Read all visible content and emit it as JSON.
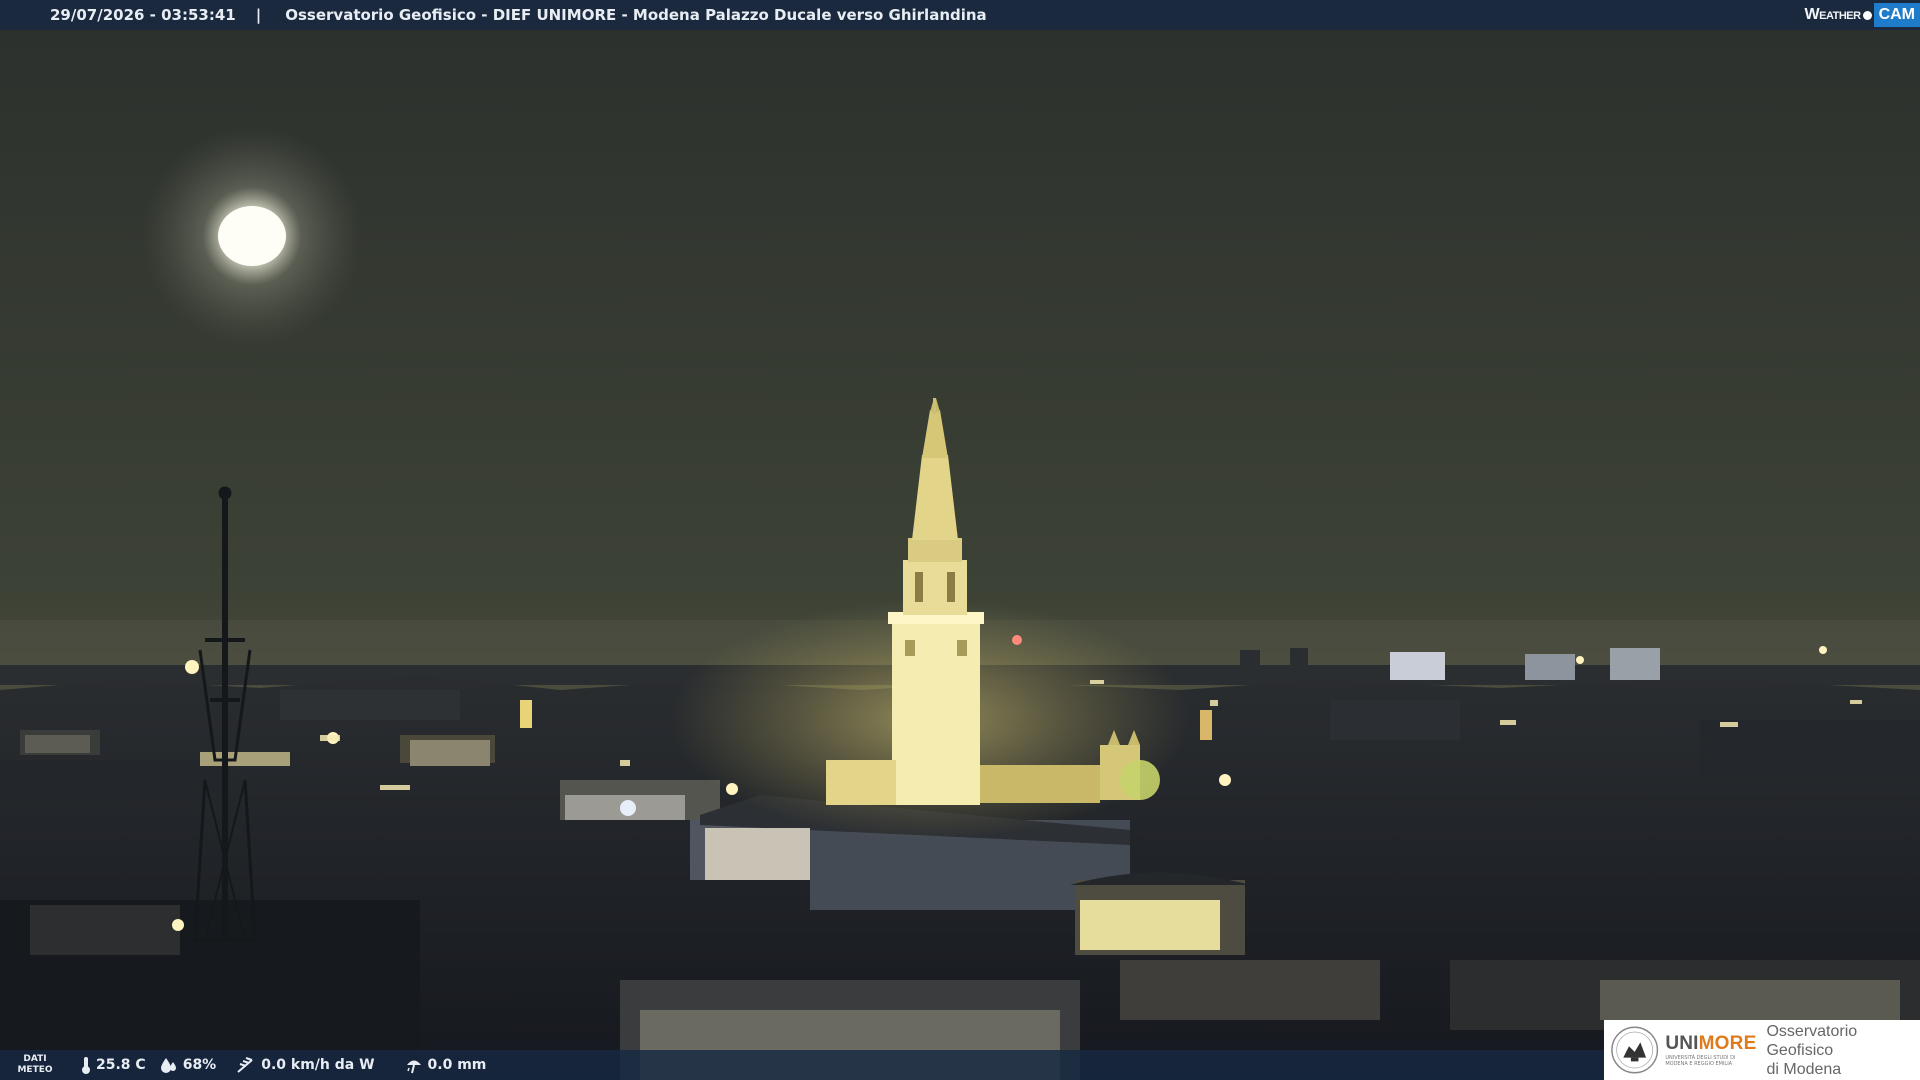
{
  "topbar": {
    "datetime": "29/07/2026 - 03:53:41",
    "separator": "|",
    "title": "Osservatorio Geofisico - DIEF UNIMORE - Modena Palazzo Ducale verso Ghirlandina"
  },
  "logo": {
    "weather_text": "Weather",
    "cam_text": "CAM"
  },
  "bottombar": {
    "dati_line1": "DATI",
    "dati_line2": "METEO",
    "temperature": "25.8 C",
    "humidity": "68%",
    "wind": "0.0 km/h da W",
    "rain": "0.0 mm",
    "icons": [
      "thermometer-icon",
      "humidity-drop-icon",
      "wind-icon",
      "rain-umbrella-icon"
    ]
  },
  "unimore": {
    "name_part1": "UNI",
    "name_part2": "MORE",
    "sub_line1": "UNIVERSITÀ DEGLI STUDI DI",
    "sub_line2": "MODENA E REGGIO EMILIA",
    "observatory_line1": "Osservatorio Geofisico",
    "observatory_line2": "di Modena"
  },
  "colors": {
    "sky": "#3a3e38",
    "bar": "#16284266",
    "accent": "#1f7ccb",
    "unimore_orange": "#e07a1a",
    "tower_light": "#f4ecb0"
  }
}
